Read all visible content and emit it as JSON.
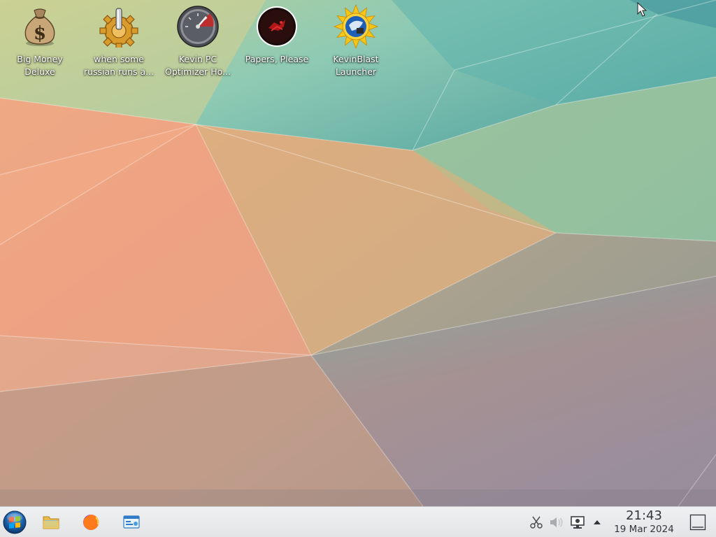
{
  "desktop": {
    "icons": [
      {
        "label": "Big Money\nDeluxe",
        "icon": "money-bag-icon"
      },
      {
        "label": "when some\nrussian runs a...",
        "icon": "gear-joystick-icon"
      },
      {
        "label": "Kevin PC\nOptimizer Ho...",
        "icon": "speedometer-icon"
      },
      {
        "label": "Papers, Please",
        "icon": "papers-please-icon"
      },
      {
        "label": "KevinBlast\nLauncher",
        "icon": "kevinblast-sun-icon"
      }
    ]
  },
  "taskbar": {
    "launchers": [
      {
        "name": "start-menu",
        "icon": "start-orb-icon"
      },
      {
        "name": "file-manager",
        "icon": "folder-icon"
      },
      {
        "name": "firefox",
        "icon": "firefox-icon"
      },
      {
        "name": "system-settings",
        "icon": "settings-window-icon"
      }
    ],
    "tray": {
      "icons": [
        "scissors-icon",
        "volume-icon",
        "network-monitor-icon",
        "expand-arrow-icon"
      ]
    },
    "clock": {
      "time": "21:43",
      "date": "19 Mar 2024"
    }
  },
  "colors": {
    "taskbar_bg": "#eff0f1",
    "clock_text": "#31363b",
    "wallpaper_orange": "#ec9e7d",
    "wallpaper_teal": "#6fc6b6",
    "wallpaper_grey": "#9c8e96"
  }
}
